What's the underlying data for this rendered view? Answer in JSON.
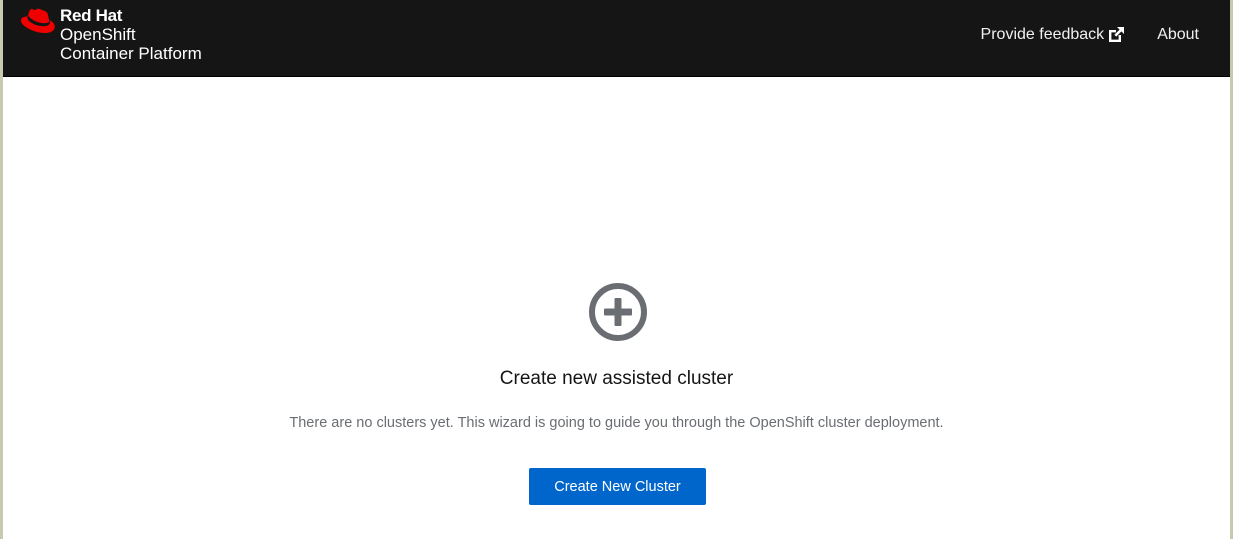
{
  "masthead": {
    "brand": {
      "company": "Red Hat",
      "product_line1": "OpenShift",
      "product_line2": "Container Platform",
      "logo_icon": "red-hat-fedora-icon"
    },
    "nav": {
      "feedback_label": "Provide feedback",
      "feedback_icon": "external-link-icon",
      "about_label": "About"
    }
  },
  "empty_state": {
    "icon": "plus-circle-icon",
    "title": "Create new assisted cluster",
    "body": "There are no clusters yet. This wizard is going to guide you through the OpenShift cluster deployment.",
    "button_label": "Create New Cluster"
  },
  "colors": {
    "masthead_bg": "#151515",
    "brand_red": "#ee0000",
    "primary": "#0066cc",
    "icon_gray": "#6a6e73"
  }
}
